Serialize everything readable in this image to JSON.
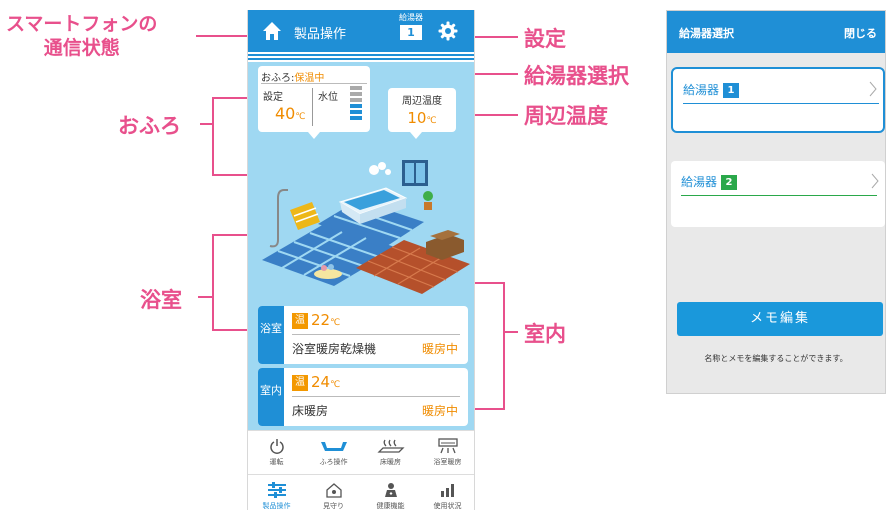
{
  "callouts": {
    "comm_status": [
      "スマートフォンの",
      "通信状態"
    ],
    "settings": "設定",
    "heater_select": "給湯器選択",
    "bath": "おふろ",
    "ambient_temp": "周辺温度",
    "bathroom": "浴室",
    "indoor": "室内"
  },
  "phone": {
    "header": {
      "title": "製品操作",
      "heater_label": "給湯器",
      "heater_number": "1"
    },
    "bath_bubble": {
      "label": "おふろ:",
      "status": "保温中",
      "set_label": "設定",
      "set_value": "40",
      "set_unit": "℃",
      "level_label": "水位"
    },
    "temp_bubble": {
      "label": "周辺温度",
      "value": "10",
      "unit": "℃"
    },
    "rooms": [
      {
        "side": "浴室",
        "badge": "温",
        "temp": "22",
        "unit": "℃",
        "device": "浴室暖房乾燥機",
        "state": "暖房中"
      },
      {
        "side": "室内",
        "badge": "温",
        "temp": "24",
        "unit": "℃",
        "device": "床暖房",
        "state": "暖房中"
      }
    ],
    "ops": [
      "運転",
      "ふろ操作",
      "床暖房",
      "浴室暖房"
    ],
    "nav": [
      "製品操作",
      "見守り",
      "健康機能",
      "使用状況"
    ]
  },
  "panel": {
    "title": "給湯器選択",
    "close": "閉じる",
    "heaters": [
      {
        "label": "給湯器",
        "num": "1"
      },
      {
        "label": "給湯器",
        "num": "2"
      }
    ],
    "memo_button": "メモ編集",
    "note": "名称とメモを編集することができます。"
  },
  "colors": {
    "accent": "#1f8fd6",
    "callout": "#e8508c",
    "warm": "#f08c00",
    "heater2": "#2aa84a",
    "sky": "#9fd8f2"
  }
}
